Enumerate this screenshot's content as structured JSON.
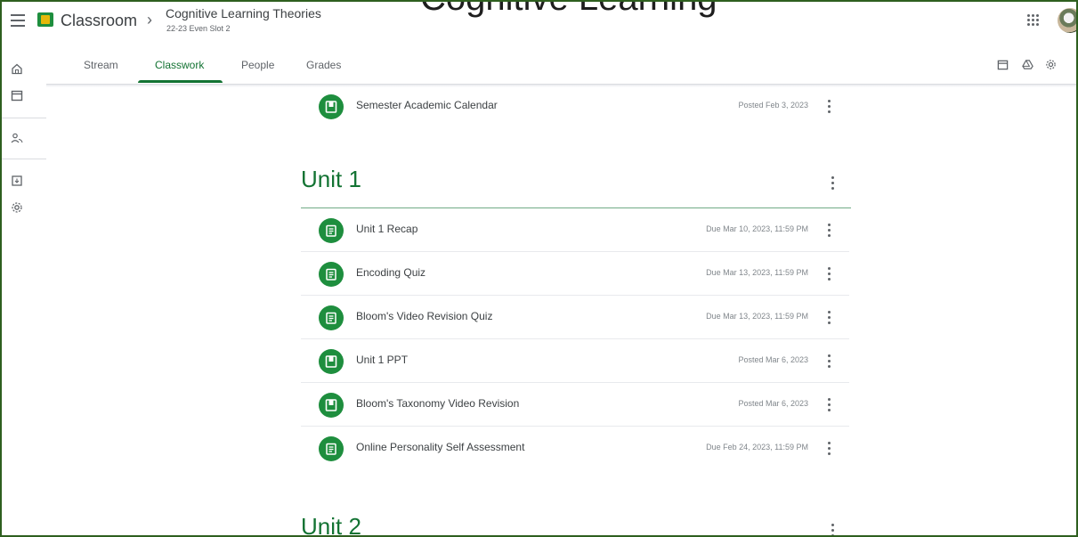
{
  "clipped_heading": "Cognitive Learning",
  "app": {
    "name": "Classroom"
  },
  "course": {
    "name": "Cognitive Learning Theories",
    "section": "22-23 Even Slot 2"
  },
  "tabs": [
    {
      "label": "Stream"
    },
    {
      "label": "Classwork"
    },
    {
      "label": "People"
    },
    {
      "label": "Grades"
    }
  ],
  "active_tab": "Classwork",
  "pinned_item": {
    "title": "Semester Academic Calendar",
    "meta": "Posted Feb 3, 2023",
    "type": "material"
  },
  "topics": [
    {
      "title": "Unit 1",
      "items": [
        {
          "title": "Unit 1 Recap",
          "meta": "Due Mar 10, 2023, 11:59 PM",
          "type": "assignment"
        },
        {
          "title": "Encoding Quiz",
          "meta": "Due Mar 13, 2023, 11:59 PM",
          "type": "assignment"
        },
        {
          "title": "Bloom's Video Revision Quiz",
          "meta": "Due Mar 13, 2023, 11:59 PM",
          "type": "assignment"
        },
        {
          "title": "Unit 1 PPT",
          "meta": "Posted Mar 6, 2023",
          "type": "material"
        },
        {
          "title": "Bloom's Taxonomy Video Revision",
          "meta": "Posted Mar 6, 2023",
          "type": "material"
        },
        {
          "title": "Online Personality Self Assessment",
          "meta": "Due Feb 24, 2023, 11:59 PM",
          "type": "assignment"
        }
      ]
    },
    {
      "title": "Unit 2",
      "items": []
    }
  ],
  "colors": {
    "brand_green": "#137333",
    "icon_green": "#1e8e3e",
    "text": "#3c4043",
    "muted": "#80868b"
  },
  "icons": {
    "menu": "hamburger-icon",
    "apps": "apps-grid-icon",
    "calendar": "calendar-icon",
    "drive": "drive-icon",
    "settings": "gear-icon",
    "home": "home-icon",
    "people": "people-icon",
    "archive": "archive-icon",
    "assignment": "assignment-icon",
    "material": "material-icon"
  }
}
